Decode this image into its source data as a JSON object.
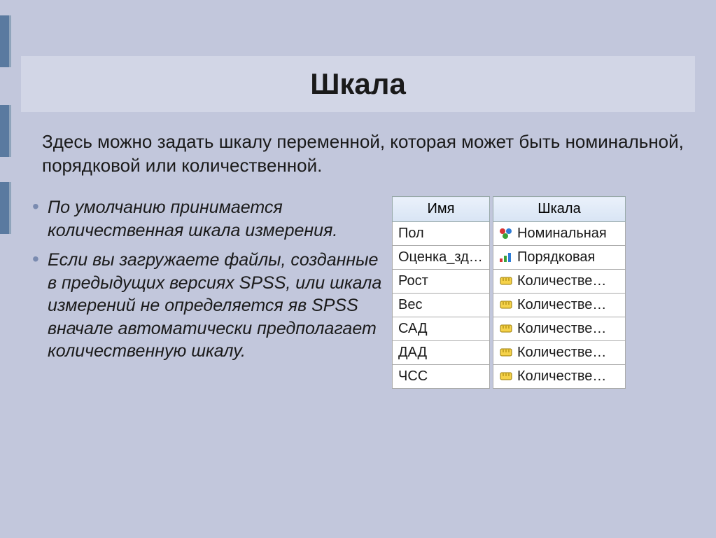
{
  "title": "Шкала",
  "description": "Здесь можно задать шкалу переменной, которая может быть номинальной, порядковой или количественной.",
  "bullets": [
    "По умолчанию принимается количественная шкала измерения.",
    "Если вы загружаете файлы, созданные в предыдущих версиях SPSS, или шкала измерений не определяется яв SPSS вначале автоматически предполагает количественную шкалу."
  ],
  "table_name": {
    "header": "Имя",
    "rows": [
      "Пол",
      "Оценка_зд…",
      "Рост",
      "Вес",
      "САД",
      "ДАД",
      "ЧСС"
    ]
  },
  "table_scale": {
    "header": "Шкала",
    "rows": [
      {
        "icon": "nominal",
        "label": "Номинальная"
      },
      {
        "icon": "ordinal",
        "label": "Порядковая"
      },
      {
        "icon": "scale",
        "label": "Количестве…"
      },
      {
        "icon": "scale",
        "label": "Количестве…"
      },
      {
        "icon": "scale",
        "label": "Количестве…"
      },
      {
        "icon": "scale",
        "label": "Количестве…"
      },
      {
        "icon": "scale",
        "label": "Количестве…"
      }
    ]
  },
  "sidebar_positions": [
    22,
    150,
    260
  ]
}
